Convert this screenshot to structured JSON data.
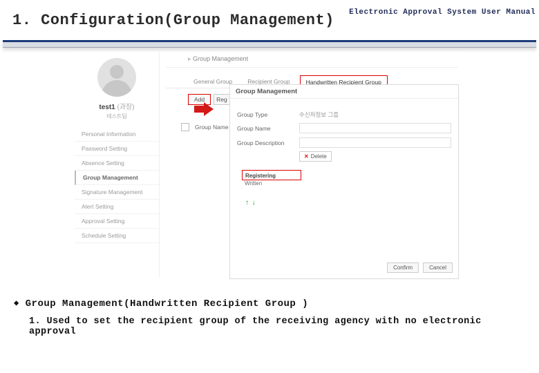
{
  "header": {
    "title": "1. Configuration(Group Management)",
    "subtitle": "Electronic Approval System User Manual"
  },
  "shot": {
    "user": {
      "name": "test1",
      "name_suffix": "(과장)",
      "sub": "테스트팀"
    },
    "sidebar": {
      "items": [
        "Personal Information",
        "Password Setting",
        "Absence Setting",
        "Group Management",
        "Signature Management",
        "Alert Setting",
        "Approval Setting",
        "Schedule Setting"
      ],
      "selected_index": 3
    },
    "breadcrumb": "Group Management",
    "tabs": {
      "items": [
        "General Group",
        "Recipient Group",
        "Handwritten Recipient Group"
      ],
      "active_index": 2
    },
    "controls": {
      "add": "Add",
      "reg": "Reg"
    },
    "list_header": "Group Name",
    "popup": {
      "title": "Group Management",
      "tab1": "Group Type",
      "tab1_val": "수신처정보 그룹",
      "gname": "Group Name",
      "gdesc": "Group Description",
      "delete": "Delete",
      "registering": "Registering",
      "written": "Written",
      "confirm": "Confirm",
      "cancel": "Cancel"
    }
  },
  "body": {
    "heading": "Group Management(Handwritten Recipient Group )",
    "line1": "1. Used to set the recipient group of the receiving agency with no electronic approval"
  }
}
